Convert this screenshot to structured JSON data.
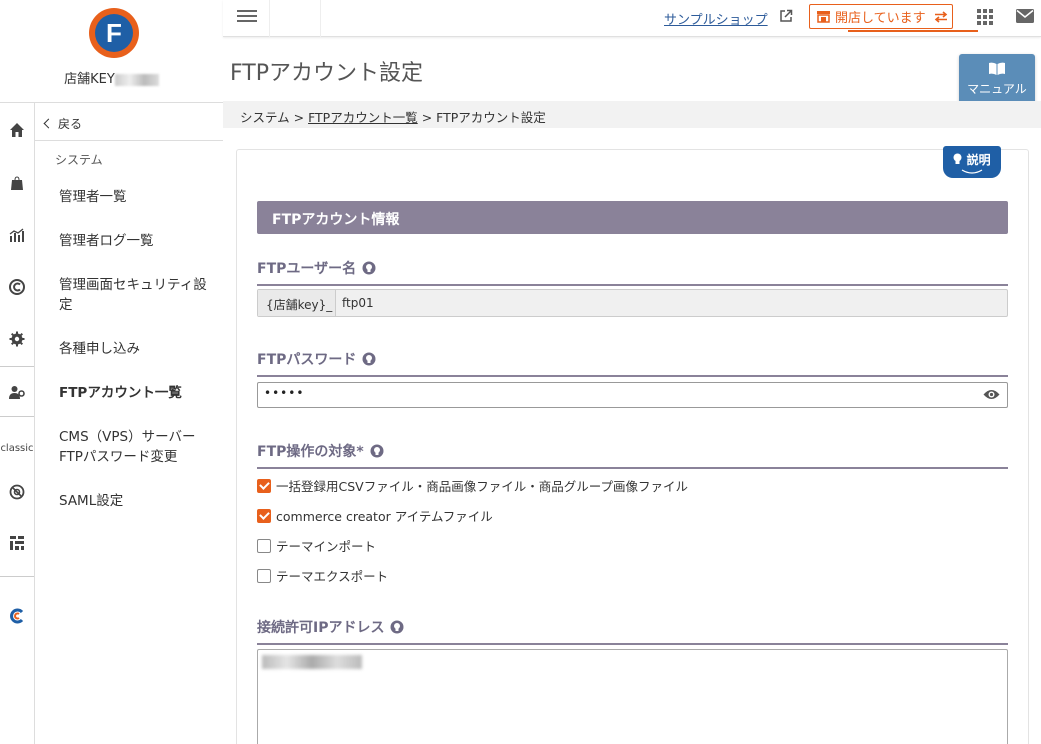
{
  "brand": {
    "store_key_label": "店舗KEY"
  },
  "rail": {
    "classic_label": "classic",
    "icons": [
      "home-icon",
      "bag-icon",
      "chart-icon",
      "c-icon",
      "gear-icon",
      "user-gear-icon",
      "classic-gear-icon",
      "tags-icon",
      "commerce-creator-icon"
    ]
  },
  "submenu": {
    "back_label": "戻る",
    "section_label": "システム",
    "items": [
      {
        "label": "管理者一覧"
      },
      {
        "label": "管理者ログ一覧"
      },
      {
        "label": "管理画面セキュリティ設定"
      },
      {
        "label": "各種申し込み"
      },
      {
        "label": "FTPアカウント一覧"
      },
      {
        "label": "CMS（VPS）サーバー FTPパスワード変更"
      },
      {
        "label": "SAML設定"
      }
    ]
  },
  "topbar": {
    "sample_shop_label": "サンプルショップ",
    "open_status_label": "開店しています"
  },
  "page": {
    "title": "FTPアカウント設定",
    "manual_label": "マニュアル"
  },
  "breadcrumb": {
    "root": "システム",
    "link": "FTPアカウント一覧",
    "current": "FTPアカウント設定",
    "separator": " > "
  },
  "form": {
    "explain_label": "説明",
    "section_title": "FTPアカウント情報",
    "username": {
      "label": "FTPユーザー名",
      "prefix": "{店舗key}_",
      "value": "ftp01"
    },
    "password": {
      "label": "FTPパスワード",
      "value": "•••••"
    },
    "targets": {
      "label": "FTP操作の対象*",
      "options": [
        {
          "label": "一括登録用CSVファイル・商品画像ファイル・商品グループ画像ファイル",
          "checked": true
        },
        {
          "label": "commerce creator アイテムファイル",
          "checked": true
        },
        {
          "label": "テーマインポート",
          "checked": false
        },
        {
          "label": "テーマエクスポート",
          "checked": false
        }
      ]
    },
    "ip": {
      "label": "接続許可IPアドレス"
    }
  },
  "colors": {
    "accent_orange": "#e8601c",
    "brand_blue": "#1f5fa6",
    "section_purple": "#8a8299",
    "manual_blue": "#5b8db8"
  }
}
